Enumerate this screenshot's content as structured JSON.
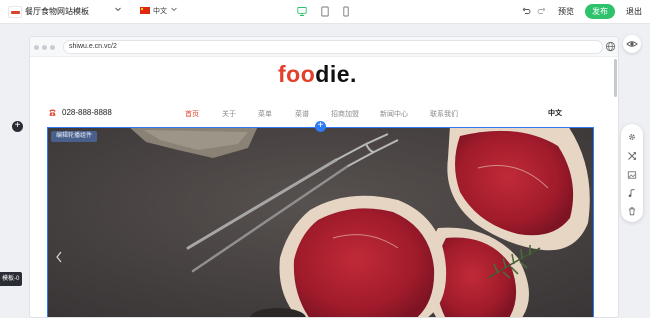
{
  "toolbar": {
    "site_name": "餐厅食物网站模板",
    "language": "中文",
    "preview": "预览",
    "publish": "发布",
    "exit": "退出"
  },
  "browser": {
    "url": "shiwu.e.cn.vc/2"
  },
  "site": {
    "brand_accent": "foo",
    "brand_rest": "die.",
    "phone": "028-888-8888",
    "nav": [
      "首页",
      "关于",
      "菜单",
      "菜谱",
      "招商加盟",
      "新闻中心",
      "联系我们"
    ],
    "language": "中文"
  },
  "editor": {
    "edit_tag": "编辑轮播组件",
    "add_symbol": "+",
    "module_tag": "模板-0"
  },
  "colors": {
    "accent": "#e3402b",
    "publish": "#2dc26b",
    "selection": "#2f7bf5"
  },
  "icons": [
    "chevron-down-icon",
    "desktop-icon",
    "tablet-icon",
    "mobile-icon",
    "undo-icon",
    "redo-icon",
    "globe-icon",
    "eye-icon",
    "phone-icon",
    "gear-icon",
    "shuffle-icon",
    "image-icon",
    "music-icon",
    "trash-icon"
  ]
}
